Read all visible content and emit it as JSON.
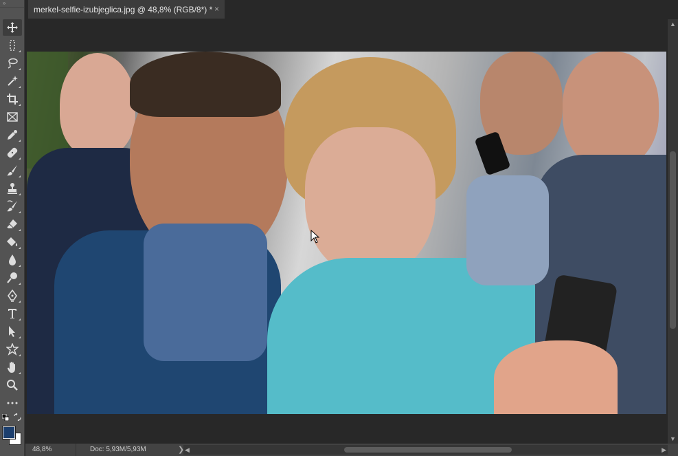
{
  "document": {
    "tab_title": "merkel-selfie-izubjeglica.jpg @ 48,8% (RGB/8*) *",
    "close_glyph": "×"
  },
  "toolbar": {
    "grip": "»",
    "tools": [
      {
        "name": "move-tool-icon",
        "active": true
      },
      {
        "name": "marquee-tool-icon"
      },
      {
        "name": "lasso-tool-icon"
      },
      {
        "name": "magic-wand-tool-icon"
      },
      {
        "name": "crop-tool-icon"
      },
      {
        "name": "frame-tool-icon"
      },
      {
        "name": "eyedropper-tool-icon"
      },
      {
        "name": "healing-brush-tool-icon"
      },
      {
        "name": "brush-tool-icon"
      },
      {
        "name": "clone-stamp-tool-icon"
      },
      {
        "name": "history-brush-tool-icon"
      },
      {
        "name": "eraser-tool-icon"
      },
      {
        "name": "paint-bucket-tool-icon"
      },
      {
        "name": "blur-tool-icon"
      },
      {
        "name": "dodge-tool-icon"
      },
      {
        "name": "pen-tool-icon"
      },
      {
        "name": "type-tool-icon"
      },
      {
        "name": "path-selection-tool-icon"
      },
      {
        "name": "shape-tool-icon"
      },
      {
        "name": "hand-tool-icon"
      },
      {
        "name": "zoom-tool-icon"
      },
      {
        "name": "more-tools-icon"
      }
    ],
    "foreground_color": "#1c3f6e",
    "background_color": "#ffffff"
  },
  "status": {
    "zoom": "48,8%",
    "doc_info": "Doc: 5,93M/5,93M",
    "menu_arrow": "❯"
  }
}
